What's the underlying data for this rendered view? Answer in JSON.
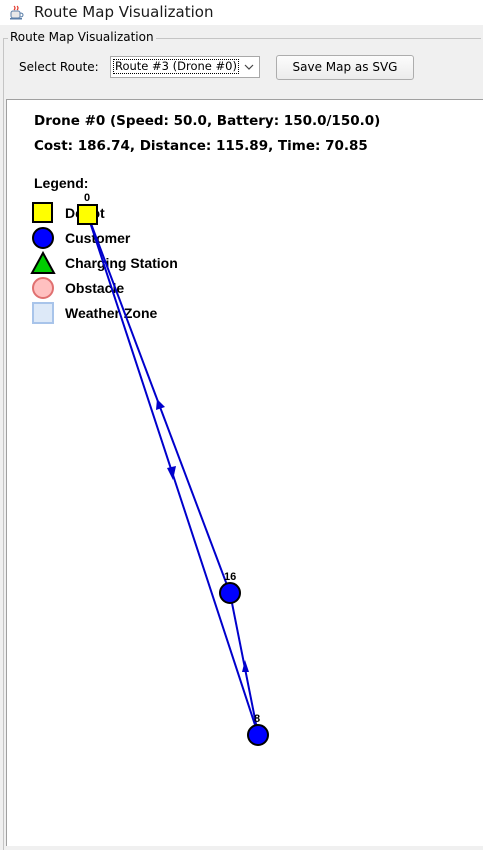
{
  "window": {
    "title": "Route Map Visualization",
    "icon": "java-coffee-cup-icon"
  },
  "panel": {
    "group_title": "Route Map Visualization",
    "route_label": "Select Route:",
    "route_selected": "Route #3 (Drone #0)",
    "save_button": "Save Map as SVG"
  },
  "info": {
    "line1": "Drone #0 (Speed: 50.0, Battery: 150.0/150.0)",
    "line2": "Cost: 186.74, Distance: 115.89, Time: 70.85"
  },
  "legend": {
    "title": "Legend:",
    "items": [
      {
        "label": "Depot",
        "shape": "square",
        "fill": "#ffff00",
        "stroke": "#000000"
      },
      {
        "label": "Customer",
        "shape": "circle",
        "fill": "#0000ff",
        "stroke": "#000000"
      },
      {
        "label": "Charging Station",
        "shape": "triangle",
        "fill": "#00cc00",
        "stroke": "#000000"
      },
      {
        "label": "Obstacle",
        "shape": "circle",
        "fill": "#ffc0c0",
        "stroke": "#e07070"
      },
      {
        "label": "Weather Zone",
        "shape": "square",
        "fill": "#dde9f8",
        "stroke": "#a8c4ea"
      }
    ]
  },
  "map": {
    "route_color": "#0000cc",
    "nodes": [
      {
        "id": "0",
        "type": "depot"
      },
      {
        "id": "16",
        "type": "customer"
      },
      {
        "id": "8",
        "type": "customer"
      }
    ]
  }
}
